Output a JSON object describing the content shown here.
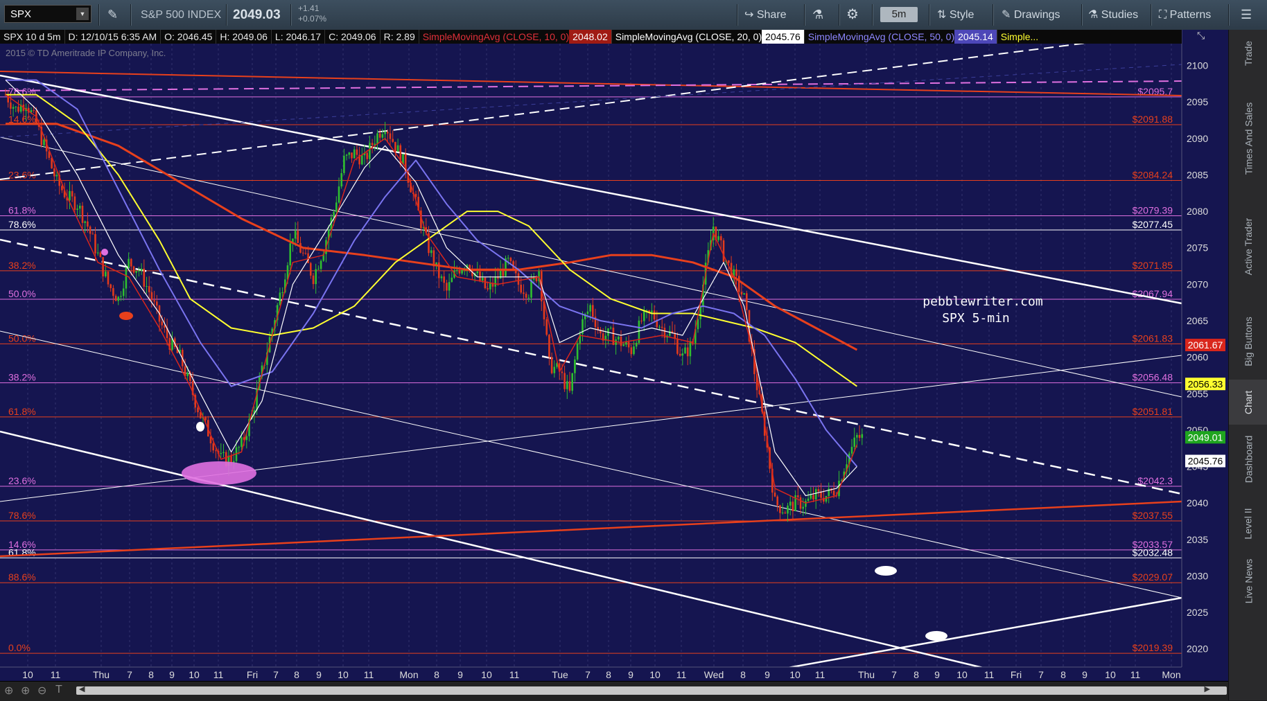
{
  "toolbar": {
    "symbol": "SPX",
    "index_name": "S&P 500 INDEX",
    "last_price": "2049.03",
    "change": "+1.41",
    "change_pct": "+0.07%",
    "share": "Share",
    "timeframe": "5m",
    "style": "Style",
    "drawings": "Drawings",
    "studies": "Studies",
    "patterns": "Patterns"
  },
  "infobar": {
    "chart_label": "SPX 10 d 5m",
    "date": "D: 12/10/15 6:35 AM",
    "open": "O: 2046.45",
    "high": "H: 2049.06",
    "low": "L: 2046.17",
    "close": "C: 2049.06",
    "range": "R: 2.89",
    "sma10_label": "SimpleMovingAvg (CLOSE, 10, 0)",
    "sma10_value": "2048.02",
    "sma20_label": "SimpleMovingAvg (CLOSE, 20, 0)",
    "sma20_value": "2045.76",
    "sma50_label": "SimpleMovingAvg (CLOSE, 50, 0)",
    "sma50_value": "2045.14",
    "more": "Simple..."
  },
  "copyright": "2015 © TD Ameritrade IP Company, Inc.",
  "annotation": {
    "site": "pebblewriter.com",
    "desc": "SPX 5-min"
  },
  "side_tabs": [
    "Trade",
    "Times And Sales",
    "Active Trader",
    "Big Buttons",
    "Chart",
    "Dashboard",
    "Level II",
    "Live News"
  ],
  "colors": {
    "background": "#151550",
    "sma10": "#d9261c",
    "sma20": "#ffffff",
    "sma50": "#7a74f0",
    "sma100": "#ffff30",
    "sma200": "#e8401c",
    "candle_up": "#2fbf2f",
    "candle_down": "#e23a1c",
    "fib_pink": "#e070e0",
    "fib_red": "#e8401c"
  },
  "chart_data": {
    "type": "candlestick",
    "ylim": [
      2017.5,
      2103
    ],
    "y_ticks": [
      2020,
      2025,
      2030,
      2035,
      2040,
      2045,
      2050,
      2055,
      2060,
      2065,
      2070,
      2075,
      2080,
      2085,
      2090,
      2095,
      2100
    ],
    "x_tick_labels": [
      "10",
      "11",
      "Thu",
      "7",
      "8",
      "9",
      "10",
      "11",
      "Fri",
      "7",
      "8",
      "9",
      "10",
      "11",
      "Mon",
      "8",
      "9",
      "10",
      "11",
      "Tue",
      "7",
      "8",
      "9",
      "10",
      "11",
      "Wed",
      "8",
      "9",
      "10",
      "11",
      "Thu",
      "7",
      "8",
      "9",
      "10",
      "11",
      "Fri",
      "7",
      "8",
      "9",
      "10",
      "11",
      "Mon"
    ],
    "price_tags": [
      {
        "label": "2061.67",
        "value": 2061.67,
        "color": "#d9261c",
        "text": "#ffffff"
      },
      {
        "label": "2056.33",
        "value": 2056.33,
        "color": "#ffff30",
        "text": "#000000"
      },
      {
        "label": "2049.01",
        "value": 2049.01,
        "color": "#1fa51f",
        "text": "#ffffff"
      },
      {
        "label": "2045.76",
        "value": 2045.76,
        "color": "#ffffff",
        "text": "#000000"
      }
    ],
    "levels": [
      {
        "price": 2095.7,
        "left": "78.6%",
        "right": "$2095.7",
        "color": "#e070e0"
      },
      {
        "price": 2091.88,
        "left": "14.6%",
        "right": "$2091.88",
        "color": "#e8401c"
      },
      {
        "price": 2084.24,
        "left": "23.6%",
        "right": "$2084.24",
        "color": "#e8401c"
      },
      {
        "price": 2079.39,
        "left": "61.8%",
        "right": "$2079.39",
        "color": "#e070e0"
      },
      {
        "price": 2077.45,
        "left": "78.6%",
        "right": "$2077.45",
        "color": "#ffffff"
      },
      {
        "price": 2071.85,
        "left": "38.2%",
        "right": "$2071.85",
        "color": "#e8401c"
      },
      {
        "price": 2067.94,
        "left": "50.0%",
        "right": "$2067.94",
        "color": "#e070e0"
      },
      {
        "price": 2061.83,
        "left": "50.0%",
        "right": "$2061.83",
        "color": "#e8401c"
      },
      {
        "price": 2056.48,
        "left": "38.2%",
        "right": "$2056.48",
        "color": "#e070e0"
      },
      {
        "price": 2051.81,
        "left": "61.8%",
        "right": "$2051.81",
        "color": "#e8401c"
      },
      {
        "price": 2042.3,
        "left": "23.6%",
        "right": "$2042.3",
        "color": "#e070e0"
      },
      {
        "price": 2037.55,
        "left": "78.6%",
        "right": "$2037.55",
        "color": "#e8401c"
      },
      {
        "price": 2033.57,
        "left": "14.6%",
        "right": "$2033.57",
        "color": "#e070e0"
      },
      {
        "price": 2032.48,
        "left": "61.8%",
        "right": "$2032.48",
        "color": "#ffffff"
      },
      {
        "price": 2029.07,
        "left": "88.6%",
        "right": "$2029.07",
        "color": "#e8401c"
      },
      {
        "price": 2019.39,
        "left": "0.0%",
        "right": "$2019.39",
        "color": "#e8401c"
      }
    ],
    "close_path": [
      [
        0,
        2096
      ],
      [
        2,
        2094
      ],
      [
        4,
        2095
      ],
      [
        6,
        2092
      ],
      [
        8,
        2088
      ],
      [
        10,
        2084
      ],
      [
        12,
        2082
      ],
      [
        14,
        2081
      ],
      [
        16,
        2078
      ],
      [
        18,
        2074
      ],
      [
        20,
        2070
      ],
      [
        22,
        2068
      ],
      [
        24,
        2073
      ],
      [
        26,
        2072
      ],
      [
        28,
        2069
      ],
      [
        30,
        2065
      ],
      [
        32,
        2062
      ],
      [
        34,
        2060
      ],
      [
        36,
        2056
      ],
      [
        38,
        2052
      ],
      [
        40,
        2049
      ],
      [
        42,
        2046
      ],
      [
        44,
        2046
      ],
      [
        46,
        2048
      ],
      [
        48,
        2052
      ],
      [
        50,
        2058
      ],
      [
        52,
        2064
      ],
      [
        54,
        2070
      ],
      [
        56,
        2077
      ],
      [
        58,
        2074
      ],
      [
        60,
        2071
      ],
      [
        62,
        2075
      ],
      [
        64,
        2080
      ],
      [
        66,
        2087
      ],
      [
        68,
        2088
      ],
      [
        70,
        2087
      ],
      [
        72,
        2090
      ],
      [
        74,
        2092
      ],
      [
        76,
        2089
      ],
      [
        78,
        2086
      ],
      [
        80,
        2081
      ],
      [
        82,
        2076
      ],
      [
        84,
        2072
      ],
      [
        86,
        2069
      ],
      [
        88,
        2072
      ],
      [
        90,
        2073
      ],
      [
        92,
        2071
      ],
      [
        94,
        2069
      ],
      [
        96,
        2071
      ],
      [
        98,
        2073
      ],
      [
        100,
        2070
      ],
      [
        102,
        2069
      ],
      [
        104,
        2072
      ],
      [
        106,
        2059
      ],
      [
        108,
        2058
      ],
      [
        110,
        2055
      ],
      [
        112,
        2064
      ],
      [
        114,
        2067
      ],
      [
        116,
        2063
      ],
      [
        118,
        2063
      ],
      [
        120,
        2062
      ],
      [
        122,
        2061
      ],
      [
        124,
        2065
      ],
      [
        126,
        2066
      ],
      [
        128,
        2064
      ],
      [
        130,
        2063
      ],
      [
        132,
        2060
      ],
      [
        134,
        2062
      ],
      [
        136,
        2070
      ],
      [
        138,
        2078
      ],
      [
        140,
        2074
      ],
      [
        142,
        2071
      ],
      [
        144,
        2068
      ],
      [
        146,
        2058
      ],
      [
        148,
        2050
      ],
      [
        150,
        2040
      ],
      [
        152,
        2039
      ],
      [
        154,
        2040
      ],
      [
        156,
        2040
      ],
      [
        158,
        2041
      ],
      [
        160,
        2041
      ],
      [
        162,
        2042
      ],
      [
        164,
        2046
      ],
      [
        166,
        2049
      ],
      [
        167,
        2049
      ]
    ],
    "sma20_path": [
      [
        0,
        2098
      ],
      [
        6,
        2094
      ],
      [
        14,
        2085
      ],
      [
        22,
        2074
      ],
      [
        30,
        2066
      ],
      [
        38,
        2055
      ],
      [
        44,
        2047
      ],
      [
        50,
        2054
      ],
      [
        56,
        2070
      ],
      [
        64,
        2079
      ],
      [
        70,
        2086
      ],
      [
        74,
        2089
      ],
      [
        80,
        2084
      ],
      [
        86,
        2075
      ],
      [
        92,
        2071
      ],
      [
        100,
        2071
      ],
      [
        104,
        2071
      ],
      [
        108,
        2062
      ],
      [
        114,
        2064
      ],
      [
        120,
        2063
      ],
      [
        126,
        2064
      ],
      [
        132,
        2063
      ],
      [
        136,
        2068
      ],
      [
        140,
        2073
      ],
      [
        144,
        2067
      ],
      [
        150,
        2047
      ],
      [
        156,
        2041
      ],
      [
        162,
        2042
      ],
      [
        166,
        2045
      ]
    ],
    "sma10_path": [
      [
        0,
        2096
      ],
      [
        6,
        2093
      ],
      [
        12,
        2082
      ],
      [
        18,
        2073
      ],
      [
        24,
        2071
      ],
      [
        30,
        2064
      ],
      [
        36,
        2056
      ],
      [
        42,
        2046
      ],
      [
        46,
        2047
      ],
      [
        52,
        2063
      ],
      [
        56,
        2073
      ],
      [
        62,
        2074
      ],
      [
        68,
        2087
      ],
      [
        74,
        2090
      ],
      [
        78,
        2086
      ],
      [
        82,
        2077
      ],
      [
        88,
        2071
      ],
      [
        96,
        2070
      ],
      [
        104,
        2071
      ],
      [
        108,
        2058
      ],
      [
        112,
        2063
      ],
      [
        120,
        2062
      ],
      [
        128,
        2063
      ],
      [
        134,
        2062
      ],
      [
        138,
        2077
      ],
      [
        142,
        2071
      ],
      [
        146,
        2060
      ],
      [
        150,
        2042
      ],
      [
        156,
        2040
      ],
      [
        162,
        2041
      ],
      [
        166,
        2048
      ]
    ],
    "sma50_path": [
      [
        0,
        2098
      ],
      [
        6,
        2098
      ],
      [
        14,
        2094
      ],
      [
        22,
        2083
      ],
      [
        30,
        2072
      ],
      [
        38,
        2062
      ],
      [
        44,
        2056
      ],
      [
        52,
        2058
      ],
      [
        60,
        2066
      ],
      [
        68,
        2076
      ],
      [
        74,
        2082
      ],
      [
        80,
        2087
      ],
      [
        86,
        2081
      ],
      [
        92,
        2076
      ],
      [
        100,
        2072
      ],
      [
        108,
        2067
      ],
      [
        116,
        2065
      ],
      [
        124,
        2064
      ],
      [
        130,
        2066
      ],
      [
        136,
        2067
      ],
      [
        142,
        2066
      ],
      [
        148,
        2063
      ],
      [
        154,
        2057
      ],
      [
        160,
        2050
      ],
      [
        166,
        2045
      ]
    ],
    "sma100_path": [
      [
        0,
        2096
      ],
      [
        6,
        2096
      ],
      [
        14,
        2092
      ],
      [
        22,
        2085
      ],
      [
        30,
        2076
      ],
      [
        36,
        2068
      ],
      [
        44,
        2064
      ],
      [
        52,
        2063
      ],
      [
        60,
        2064
      ],
      [
        68,
        2067
      ],
      [
        76,
        2073
      ],
      [
        84,
        2077
      ],
      [
        90,
        2080
      ],
      [
        96,
        2080
      ],
      [
        102,
        2078
      ],
      [
        110,
        2072
      ],
      [
        118,
        2068
      ],
      [
        126,
        2066
      ],
      [
        134,
        2066
      ],
      [
        140,
        2065
      ],
      [
        146,
        2064
      ],
      [
        154,
        2062
      ],
      [
        160,
        2059
      ],
      [
        166,
        2056
      ]
    ],
    "sma200_path": [
      [
        0,
        2092
      ],
      [
        10,
        2092
      ],
      [
        22,
        2089
      ],
      [
        34,
        2084
      ],
      [
        46,
        2079
      ],
      [
        58,
        2075
      ],
      [
        70,
        2074
      ],
      [
        80,
        2073
      ],
      [
        90,
        2072
      ],
      [
        100,
        2072
      ],
      [
        110,
        2073
      ],
      [
        118,
        2074
      ],
      [
        126,
        2074
      ],
      [
        134,
        2073
      ],
      [
        142,
        2071
      ],
      [
        150,
        2067
      ],
      [
        158,
        2064
      ],
      [
        166,
        2061
      ]
    ]
  }
}
